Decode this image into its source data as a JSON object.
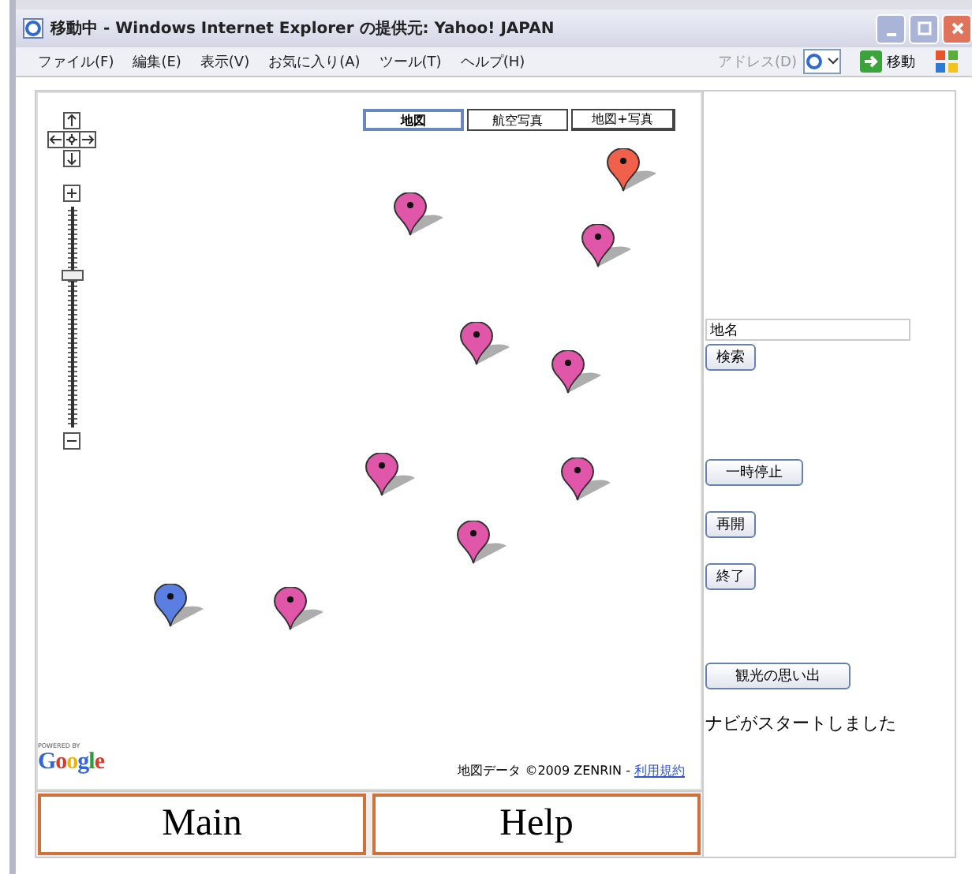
{
  "window": {
    "title": "移動中 - Windows Internet Explorer の提供元: Yahoo! JAPAN"
  },
  "menu": [
    "ファイル(F)",
    "編集(E)",
    "表示(V)",
    "お気に入り(A)",
    "ツール(T)",
    "ヘルプ(H)"
  ],
  "address_bar": {
    "label": "アドレス(D)",
    "go": "移動"
  },
  "map": {
    "type_tabs": [
      {
        "label": "地図",
        "selected": true
      },
      {
        "label": "航空写真",
        "selected": false
      },
      {
        "label": "地図+写真",
        "selected": false
      }
    ],
    "zoom": {
      "level": 0.68
    },
    "markers": [
      {
        "color": "#f0604a"
      },
      {
        "color": "#e056a8"
      },
      {
        "color": "#e056a8"
      },
      {
        "color": "#e056a8"
      },
      {
        "color": "#e056a8"
      },
      {
        "color": "#e056a8"
      },
      {
        "color": "#e056a8"
      },
      {
        "color": "#e056a8"
      },
      {
        "color": "#e056a8"
      },
      {
        "color": "#5b7fe0"
      }
    ],
    "powered_by": "POWERED BY",
    "logo": "Google",
    "attribution": "地図データ ©2009 ZENRIN - ",
    "terms_link": "利用規約"
  },
  "sidebar": {
    "search": {
      "value": "地名"
    },
    "buttons": [
      "検索",
      "一時停止",
      "再開",
      "終了",
      "観光の思い出"
    ],
    "status": "ナビがスタートしました"
  },
  "nav": [
    "Main",
    "Help"
  ]
}
